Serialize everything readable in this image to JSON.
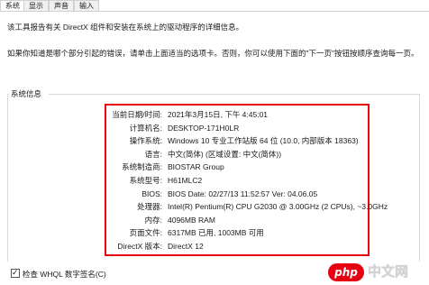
{
  "tabs": [
    {
      "label": "系统",
      "active": true
    },
    {
      "label": "显示",
      "active": false
    },
    {
      "label": "声音",
      "active": false
    },
    {
      "label": "输入",
      "active": false
    }
  ],
  "intro_text": "该工具报告有关 DirectX 组件和安装在系统上的驱动程序的详细信息。",
  "intro_text_2": "如果你知道是哪个部分引起的错误，请单击上面适当的选项卡。否则，你可以使用下面的\"下一页\"按钮按顺序查询每一页。",
  "group_title": "系统信息",
  "system_info": [
    {
      "label": "当前日期/时间:",
      "value": "2021年3月15日, 下午 4:45:01"
    },
    {
      "label": "计算机名:",
      "value": "DESKTOP-171H0LR"
    },
    {
      "label": "操作系统:",
      "value": "Windows 10 专业工作站版 64 位 (10.0, 内部版本 18363)"
    },
    {
      "label": "语言:",
      "value": "中文(简体) (区域设置: 中文(简体))"
    },
    {
      "label": "系统制造商:",
      "value": "BIOSTAR Group"
    },
    {
      "label": "系统型号:",
      "value": "H61MLC2"
    },
    {
      "label": "BIOS:",
      "value": "BIOS Date: 02/27/13 11:52:57 Ver: 04.06.05"
    },
    {
      "label": "处理器:",
      "value": "Intel(R) Pentium(R) CPU G2030 @ 3.00GHz (2 CPUs), ~3.0GHz"
    },
    {
      "label": "内存:",
      "value": "4096MB RAM"
    },
    {
      "label": "页面文件:",
      "value": "6317MB 已用, 1003MB 可用"
    },
    {
      "label": "DirectX 版本:",
      "value": "DirectX 12"
    }
  ],
  "whql_label": "检查 WHQL 数字签名(C)",
  "whql_checked": true,
  "watermark": {
    "logo": "php",
    "text": "中文网"
  },
  "colors": {
    "highlight_border": "#e8000b",
    "watermark_red": "#e60012"
  }
}
